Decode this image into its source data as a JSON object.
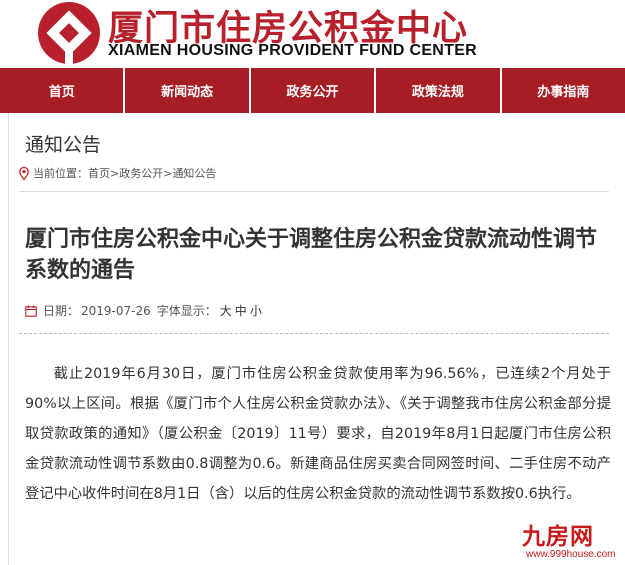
{
  "header": {
    "title_cn": "厦门市住房公积金中心",
    "title_en": "XIAMEN HOUSING PROVIDENT FUND CENTER",
    "logo_icon": "house-emblem-icon",
    "brand_color": "#a61e24"
  },
  "nav": {
    "items": [
      {
        "label": "首页"
      },
      {
        "label": "新闻动态"
      },
      {
        "label": "政务公开"
      },
      {
        "label": "政策法规"
      },
      {
        "label": "办事指南"
      }
    ]
  },
  "section": {
    "title": "通知公告"
  },
  "breadcrumb": {
    "icon": "location-pin-icon",
    "prefix": "当前位置：",
    "home": "首页",
    "sep1": ">",
    "level1": "政务公开",
    "sep2": ">",
    "current": "通知公告"
  },
  "article": {
    "title": "厦门市住房公积金中心关于调整住房公积金贷款流动性调节系数的通告",
    "meta": {
      "icon": "calendar-icon",
      "date_label": "日期：",
      "date": "2019-07-26",
      "font_label": "字体显示：",
      "size_large": "大",
      "size_medium": "中",
      "size_small": "小"
    },
    "body": "截止2019年6月30日，厦门市住房公积金贷款使用率为96.56%，已连续2个月处于90%以上区间。根据《厦门市个人住房公积金贷款办法》、《关于调整我市住房公积金部分提取贷款政策的通知》（厦公积金〔2019〕11号）要求，自2019年8月1日起厦门市住房公积金贷款流动性调节系数由0.8调整为0.6。新建商品住房买卖合同网签时间、二手住房不动产登记中心收件时间在8月1日（含）以后的住房公积金贷款的流动性调节系数按0.6执行。"
  },
  "watermark": {
    "main": "九房网",
    "url": "www.999house.com"
  }
}
